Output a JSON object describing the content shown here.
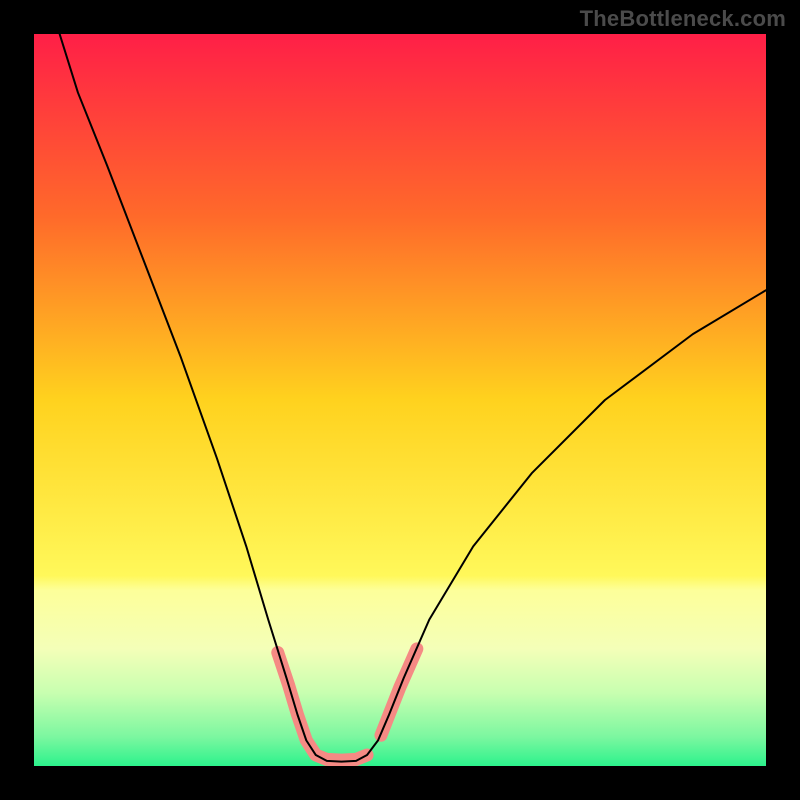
{
  "watermark": "TheBottleneck.com",
  "chart_data": {
    "type": "line",
    "title": "",
    "xlabel": "",
    "ylabel": "",
    "xlim": [
      0,
      100
    ],
    "ylim": [
      0,
      100
    ],
    "gradient_stops": [
      {
        "offset": 0,
        "color": "#ff1f47"
      },
      {
        "offset": 25,
        "color": "#ff6a2a"
      },
      {
        "offset": 50,
        "color": "#ffd21e"
      },
      {
        "offset": 74,
        "color": "#fff85a"
      },
      {
        "offset": 76,
        "color": "#fdff9a"
      },
      {
        "offset": 84,
        "color": "#f4ffb8"
      },
      {
        "offset": 90,
        "color": "#c8ffb0"
      },
      {
        "offset": 96,
        "color": "#7cf7a0"
      },
      {
        "offset": 100,
        "color": "#2cf28c"
      }
    ],
    "series": [
      {
        "name": "curve",
        "stroke": "#000000",
        "stroke_width": 2,
        "points": [
          {
            "x": 3.5,
            "y": 100.0
          },
          {
            "x": 6.0,
            "y": 92.0
          },
          {
            "x": 10.0,
            "y": 82.0
          },
          {
            "x": 15.0,
            "y": 69.0
          },
          {
            "x": 20.0,
            "y": 56.0
          },
          {
            "x": 25.0,
            "y": 42.0
          },
          {
            "x": 29.0,
            "y": 30.0
          },
          {
            "x": 32.0,
            "y": 20.0
          },
          {
            "x": 34.5,
            "y": 12.0
          },
          {
            "x": 36.0,
            "y": 7.0
          },
          {
            "x": 37.2,
            "y": 3.5
          },
          {
            "x": 38.5,
            "y": 1.5
          },
          {
            "x": 40.0,
            "y": 0.7
          },
          {
            "x": 42.0,
            "y": 0.6
          },
          {
            "x": 44.0,
            "y": 0.7
          },
          {
            "x": 45.5,
            "y": 1.5
          },
          {
            "x": 47.0,
            "y": 3.5
          },
          {
            "x": 48.5,
            "y": 7.0
          },
          {
            "x": 50.5,
            "y": 12.0
          },
          {
            "x": 54.0,
            "y": 20.0
          },
          {
            "x": 60.0,
            "y": 30.0
          },
          {
            "x": 68.0,
            "y": 40.0
          },
          {
            "x": 78.0,
            "y": 50.0
          },
          {
            "x": 90.0,
            "y": 59.0
          },
          {
            "x": 100.0,
            "y": 65.0
          }
        ]
      },
      {
        "name": "marker-band",
        "stroke": "#f58a84",
        "stroke_width": 13,
        "linecap": "round",
        "segments": [
          [
            {
              "x": 33.3,
              "y": 15.5
            },
            {
              "x": 34.8,
              "y": 11.0
            },
            {
              "x": 36.0,
              "y": 7.0
            },
            {
              "x": 37.2,
              "y": 3.5
            },
            {
              "x": 38.5,
              "y": 1.5
            },
            {
              "x": 40.0,
              "y": 0.9
            },
            {
              "x": 42.0,
              "y": 0.8
            },
            {
              "x": 44.0,
              "y": 0.9
            },
            {
              "x": 45.5,
              "y": 1.5
            }
          ],
          [
            {
              "x": 47.4,
              "y": 4.2
            },
            {
              "x": 48.5,
              "y": 7.0
            },
            {
              "x": 50.0,
              "y": 10.8
            },
            {
              "x": 51.2,
              "y": 13.5
            },
            {
              "x": 52.3,
              "y": 16.0
            }
          ]
        ]
      }
    ]
  }
}
